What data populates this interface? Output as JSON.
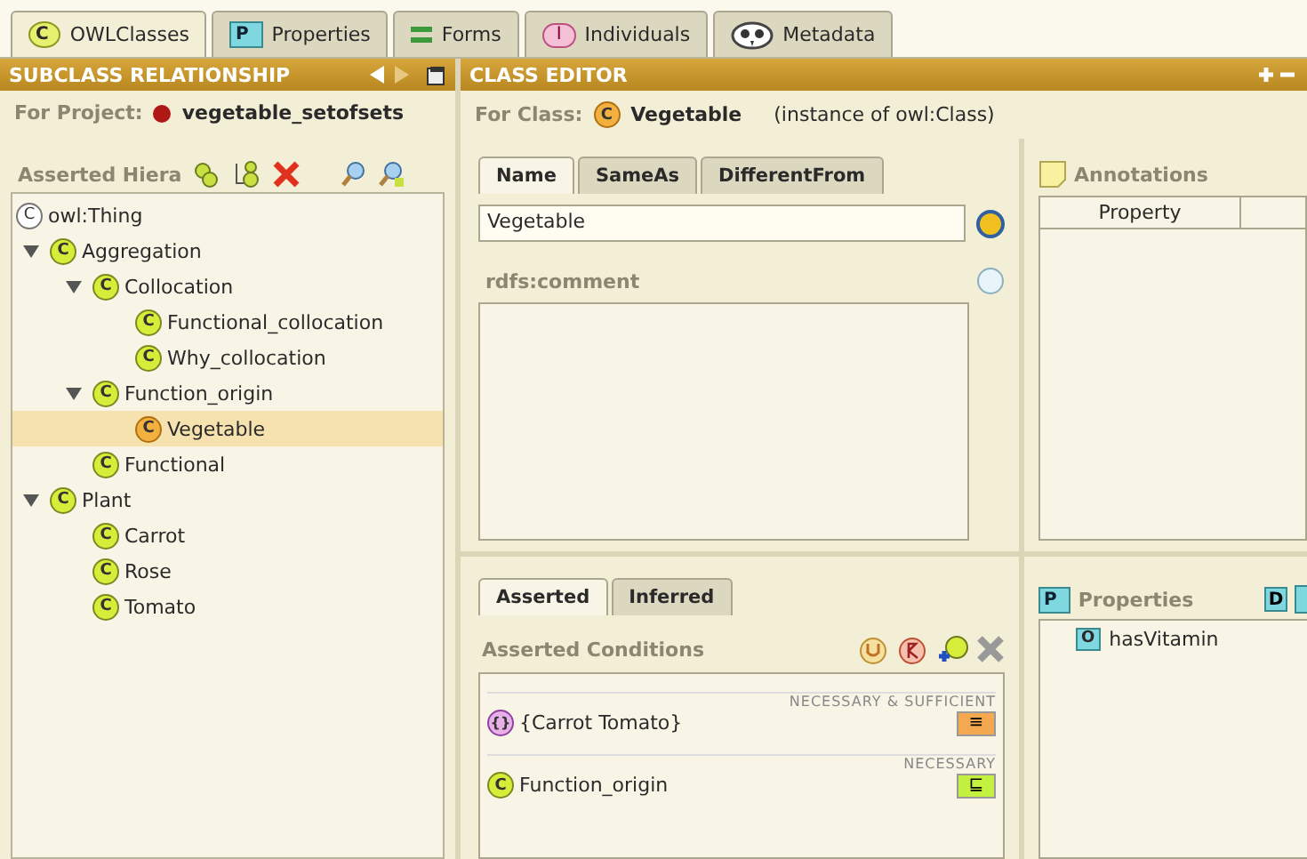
{
  "top_tabs": [
    {
      "kind": "class",
      "glyph": "C",
      "label": "OWLClasses",
      "selected": true
    },
    {
      "kind": "property",
      "glyph": "P",
      "label": "Properties",
      "selected": false
    },
    {
      "kind": "forms",
      "label": "Forms",
      "selected": false
    },
    {
      "kind": "individual",
      "glyph": "I",
      "label": "Individuals",
      "selected": false
    },
    {
      "kind": "metadata",
      "label": "Metadata",
      "selected": false
    }
  ],
  "left_panel": {
    "title": "SUBCLASS RELATIONSHIP",
    "project_label": "For Project:",
    "project_name": "vegetable_setofsets",
    "hierarchy_label": "Asserted Hiera",
    "root": {
      "glyph": "C",
      "label": "owl:Thing"
    },
    "tree": [
      {
        "glyph": "C",
        "label": "Aggregation",
        "expanded": true,
        "selected": false,
        "children": [
          {
            "glyph": "C",
            "label": "Collocation",
            "expanded": true,
            "selected": false,
            "children": [
              {
                "glyph": "C",
                "label": "Functional_collocation",
                "selected": false
              },
              {
                "glyph": "C",
                "label": "Why_collocation",
                "selected": false
              }
            ]
          },
          {
            "glyph": "C",
            "label": "Function_origin",
            "expanded": true,
            "selected": false,
            "children": [
              {
                "glyph": "C",
                "label": "Vegetable",
                "selected": true
              }
            ]
          },
          {
            "glyph": "C",
            "label": "Functional",
            "selected": false
          }
        ]
      },
      {
        "glyph": "C",
        "label": "Plant",
        "expanded": true,
        "selected": false,
        "children": [
          {
            "glyph": "C",
            "label": "Carrot",
            "selected": false
          },
          {
            "glyph": "C",
            "label": "Rose",
            "selected": false
          },
          {
            "glyph": "C",
            "label": "Tomato",
            "selected": false
          }
        ]
      }
    ]
  },
  "class_editor": {
    "title": "CLASS EDITOR",
    "class_label": "For Class:",
    "class_glyph": "C",
    "class_name": "Vegetable",
    "class_type": "(instance of owl:Class)",
    "tabs": [
      {
        "label": "Name",
        "selected": true
      },
      {
        "label": "SameAs",
        "selected": false
      },
      {
        "label": "DifferentFrom",
        "selected": false
      }
    ],
    "name_value": "Vegetable",
    "comment_label": "rdfs:comment",
    "annotations": {
      "title": "Annotations",
      "columns": [
        "Property"
      ]
    },
    "condition_tabs": [
      {
        "label": "Asserted",
        "selected": true
      },
      {
        "label": "Inferred",
        "selected": false
      }
    ],
    "conditions_title": "Asserted Conditions",
    "conditions": [
      {
        "kind": "enumeration",
        "section": "NECESSARY & SUFFICIENT",
        "glyph": "{}",
        "label": "{Carrot Tomato}",
        "operator": "≡"
      },
      {
        "kind": "class",
        "section": "NECESSARY",
        "glyph": "C",
        "label": "Function_origin",
        "operator": "⊑"
      }
    ],
    "properties": {
      "glyph": "P",
      "title": "Properties",
      "tool_glyph": "D",
      "items": [
        {
          "glyph": "O",
          "label": "hasVitamin"
        }
      ]
    }
  }
}
